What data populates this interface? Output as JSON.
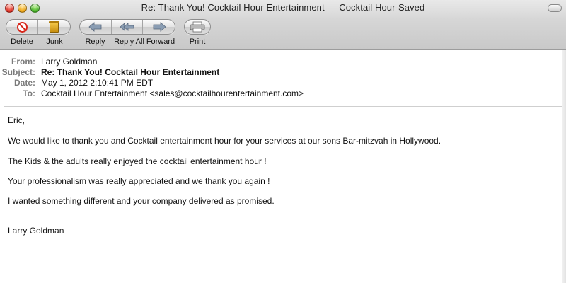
{
  "window": {
    "title": "Re: Thank You! Cocktail Hour Entertainment — Cocktail Hour-Saved"
  },
  "toolbar": {
    "delete_label": "Delete",
    "junk_label": "Junk",
    "reply_label": "Reply",
    "reply_all_label": "Reply All",
    "forward_label": "Forward",
    "print_label": "Print"
  },
  "headers": {
    "from_label": "From:",
    "from_value": "Larry Goldman",
    "subject_label": "Subject:",
    "subject_value": "Re: Thank You! Cocktail Hour Entertainment",
    "date_label": "Date:",
    "date_value": "May 1, 2012 2:10:41 PM EDT",
    "to_label": "To:",
    "to_value": "Cocktail Hour Entertainment <sales@cocktailhourentertainment.com>"
  },
  "message": {
    "greeting": "Eric,",
    "line1": "We would like to thank you and Cocktail entertainment hour for your services at our sons Bar-mitzvah in Hollywood.",
    "line2": "The Kids & the adults really enjoyed the cocktail entertainment hour !",
    "line3": "Your professionalism was really appreciated and we thank you again !",
    "line4": "I wanted something different and your company delivered as promised.",
    "signature": "Larry Goldman"
  },
  "colors": {
    "delete_red": "#d7261a",
    "junk_gold": "#e0aa2a",
    "header_label_gray": "#7a7a7a"
  },
  "icons": {
    "delete": "no-entry-icon",
    "junk": "trash-bag-icon",
    "reply": "arrow-left-icon",
    "reply_all": "double-arrow-left-icon",
    "forward": "arrow-right-icon",
    "print": "printer-icon"
  }
}
